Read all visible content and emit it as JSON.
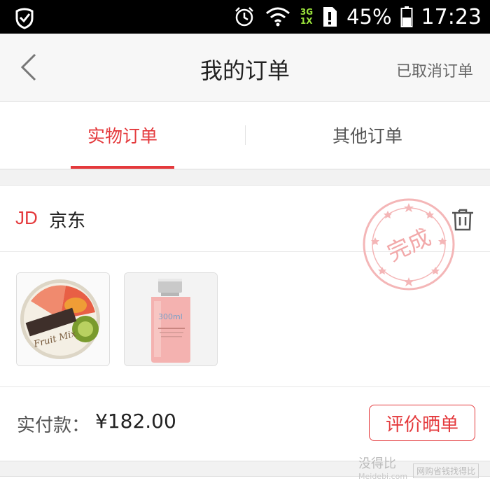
{
  "status_bar": {
    "network": [
      "3G",
      "1X"
    ],
    "battery": "45%",
    "time": "17:23"
  },
  "navbar": {
    "title": "我的订单",
    "cancelled_link": "已取消订单"
  },
  "tabs": [
    {
      "label": "实物订单",
      "active": true
    },
    {
      "label": "其他订单",
      "active": false
    }
  ],
  "order": {
    "shop_logo": "JD",
    "shop_name": "京东",
    "stamp_text": "完成",
    "payment_label": "实付款：",
    "payment_amount": "¥182.00",
    "review_button": "评价晒单",
    "products": [
      {
        "name": "Fruit Mix cleansing cream",
        "icon": "cream-jar"
      },
      {
        "name": "pink toner bottle",
        "icon": "toner-bottle"
      }
    ]
  },
  "watermark": {
    "main": "没得比",
    "sub": "Meidebi.com",
    "box": "网购省钱找得比"
  },
  "colors": {
    "accent": "#e4393c"
  }
}
